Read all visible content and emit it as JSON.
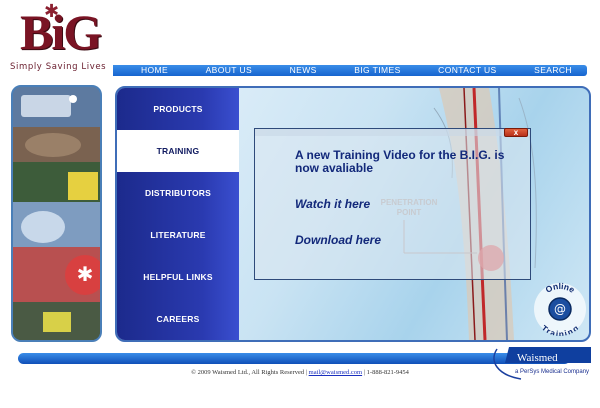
{
  "logo": {
    "text": "BiG",
    "tagline": "Simply Saving Lives"
  },
  "topnav": [
    "HOME",
    "ABOUT US",
    "NEWS",
    "BIG TIMES",
    "CONTACT US",
    "SEARCH"
  ],
  "side_menu": {
    "active_index": 1,
    "items": [
      "PRODUCTS",
      "TRAINING",
      "DISTRIBUTORS",
      "LITERATURE",
      "HELPFUL LINKS",
      "CAREERS"
    ]
  },
  "popup": {
    "close_label": "x",
    "title": "A new Training Video for the B.I.G. is now avaliable",
    "watch_link": "Watch it here",
    "download_link": "Download here"
  },
  "art": {
    "penetration_label": "PENETRATION POINT"
  },
  "online_training": {
    "line1": "Online",
    "line2": "Training",
    "icon": "at-sign-icon"
  },
  "footer": {
    "copyright": "© 2009 Waismed Ltd., All Rights Reserved | ",
    "email": "mail@waismed.com",
    "phone": " | 1-888-821-9454",
    "company": "Waismed",
    "company_sub": "a PerSys Medical Company"
  },
  "colors": {
    "brand_maroon": "#7a1424",
    "nav_blue": "#1664cf",
    "menu_navy": "#1c2a8c",
    "text_navy": "#12287a",
    "close_red": "#c8401e"
  }
}
